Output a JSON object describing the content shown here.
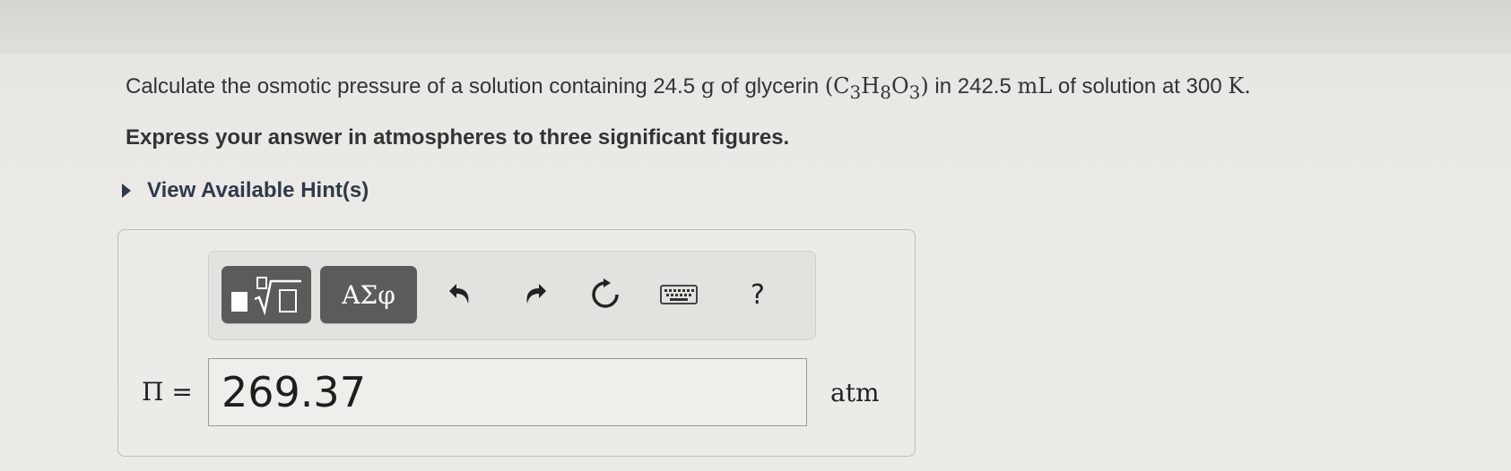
{
  "question": {
    "prefix": "Calculate the osmotic pressure of a solution containing ",
    "mass_value": "24.5",
    "mass_unit": "g",
    "of_text": " of glycerin ",
    "formula": "(C",
    "sub_c": "3",
    "h": "H",
    "sub_h": "8",
    "o": "O",
    "sub_o": "3",
    "close": ")",
    "in_text": " in ",
    "volume_value": "242.5",
    "volume_unit": "mL",
    "at_text": " of solution at ",
    "temp_value": "300",
    "temp_unit": "K."
  },
  "instruction": "Express your answer in atmospheres to three significant figures.",
  "hints_label": "View Available Hint(s)",
  "toolbar": {
    "greek_label": "ΑΣφ",
    "help_label": "?"
  },
  "answer": {
    "variable": "Π =",
    "value": "269.37",
    "unit": "atm"
  },
  "icons": [
    "templates-icon",
    "undo-icon",
    "redo-icon",
    "reset-icon",
    "keyboard-icon",
    "help-icon"
  ]
}
